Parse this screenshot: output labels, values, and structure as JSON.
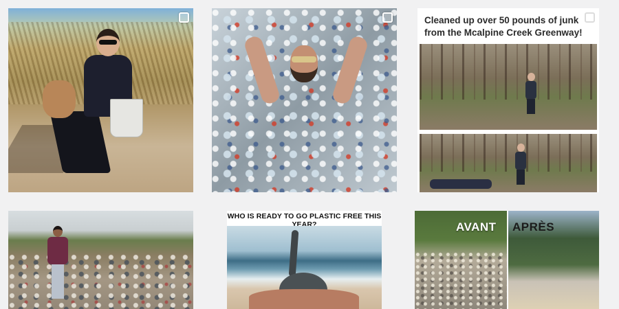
{
  "feed": {
    "posts": [
      {
        "id_label": "post-beach-cleanup",
        "multi_image": true
      },
      {
        "id_label": "post-plastic-bottles",
        "multi_image": true
      },
      {
        "caption": "Cleaned up over 50 pounds of junk from the Mcalpine Creek Greenway!",
        "multi_image": true
      },
      {
        "id_label": "post-dump-site"
      },
      {
        "headline": "WHO IS READY TO GO PLASTIC FREE THIS YEAR?"
      },
      {
        "before_label": "AVANT",
        "after_label": "APRÈS"
      }
    ]
  },
  "icons": {
    "multi_image": "multiple-images-icon"
  },
  "colors": {
    "page_background": "#f1f1f2",
    "card_background": "#ffffff",
    "caption_text": "#2b2b2b"
  }
}
